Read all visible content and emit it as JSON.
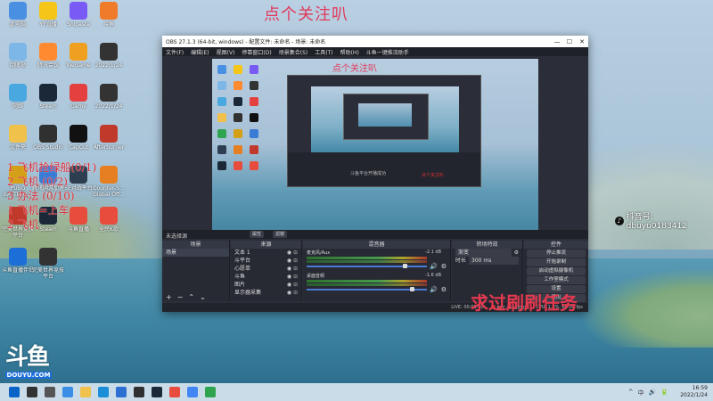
{
  "overlay": {
    "top_title": "点个关注叭",
    "bottom_banner": "求过刷刷任务",
    "watermark_handle": "抖音号: dbuyu0183412",
    "watermark_icon": "♪",
    "red_lines": [
      "1 飞机抢绿船(0/1)",
      "2 飞机",
      "3 办法",
      "1 飞机=上车",
      "2 飞机"
    ],
    "red_counts": [
      "(0/2)",
      "(0/10)"
    ],
    "logo_big": "斗鱼",
    "logo_small": "DOUYU.COM"
  },
  "desktop_icons": [
    {
      "label": "此电脑",
      "color": "#4a90e2"
    },
    {
      "label": "YY直播",
      "color": "#f5c518"
    },
    {
      "label": "Snipaste",
      "color": "#7a5af5"
    },
    {
      "label": "斗鱼",
      "color": "#f07b2a"
    },
    {
      "label": "回收站",
      "color": "#7db7e8"
    },
    {
      "label": "腾讯会议",
      "color": "#ff8a30"
    },
    {
      "label": "WeGame",
      "color": "#f0a020"
    },
    {
      "label": "2022/1/24",
      "color": "#333333"
    },
    {
      "label": "网络",
      "color": "#4aa8e0"
    },
    {
      "label": "Steam",
      "color": "#1b2838"
    },
    {
      "label": "Game",
      "color": "#e44040"
    },
    {
      "label": "2022/1/24",
      "color": "#333333"
    },
    {
      "label": "文件夹",
      "color": "#f0c14b"
    },
    {
      "label": "OBS Studio",
      "color": "#303030"
    },
    {
      "label": "CapCut",
      "color": "#111111"
    },
    {
      "label": "Afterburner",
      "color": "#c0392b"
    },
    {
      "label": "PUBG BATTLEG...",
      "color": "#d4a017"
    },
    {
      "label": "腾讯网游加速器",
      "color": "#3a7bd5"
    },
    {
      "label": "5E对战平台",
      "color": "#2c3e50"
    },
    {
      "label": "Counter-S... Global Off...",
      "color": "#e67e22"
    },
    {
      "label": "完美世界竞技平台",
      "color": "#c0392b"
    },
    {
      "label": "Steam",
      "color": "#1b2838"
    },
    {
      "label": "斗鱼直播",
      "color": "#e74c3c"
    },
    {
      "label": "全民K歌",
      "color": "#e74c3c"
    },
    {
      "label": "斗鱼直播伴侣",
      "color": "#1d6fd8"
    },
    {
      "label": "完美世界竞技平台",
      "color": "#333333"
    }
  ],
  "obs": {
    "title": "OBS 27.1.3 (64-bit, windows) - 配置文件: 未命名 - 场景: 未命名",
    "menu": [
      "文件(F)",
      "编辑(E)",
      "视图(V)",
      "停靠窗口(D)",
      "场景集合(S)",
      "工具(T)",
      "帮助(H)",
      "斗鱼一键推流助手"
    ],
    "preview_nested_text": "斗鱼平台开播成功",
    "preview_nested_red": "点个关注叭",
    "mode_label": "未选择源",
    "mode_buttons": [
      "属性",
      "滤镜"
    ],
    "scenes_header": "场景",
    "scenes": [
      "场景"
    ],
    "sources_header": "来源",
    "sources": [
      "文本 1",
      "斗平台",
      "心愿单",
      "斗鱼",
      "图片",
      "显示器采集"
    ],
    "mixer_header": "混音器",
    "mixer_channels": [
      {
        "name": "麦克风/Aux",
        "db": "-2.1 dB"
      },
      {
        "name": "桌面音频",
        "db": "-1.6 dB"
      }
    ],
    "transitions_header": "转场特效",
    "transition_value": "渐变",
    "duration_label": "时长",
    "duration_value": "300 ms",
    "controls_header": "控件",
    "controls": [
      "停止推流",
      "开始录制",
      "启动虚拟摄像机",
      "工作室模式",
      "设置",
      "退出"
    ],
    "status": {
      "live": "LIVE: 00:00:00",
      "rec": "REC: 00:00:00",
      "cpu": "CPU: 1.8%, 60.00 fps"
    }
  },
  "taskbar": {
    "apps": [
      "start",
      "search",
      "task-view",
      "widgets",
      "explorer",
      "edge",
      "store",
      "obs",
      "steam",
      "douyu",
      "chrome",
      "wechat"
    ],
    "tray": [
      "^",
      "中",
      "🔊",
      "🔋"
    ],
    "time": "16:59",
    "date": "2022/1/24"
  }
}
